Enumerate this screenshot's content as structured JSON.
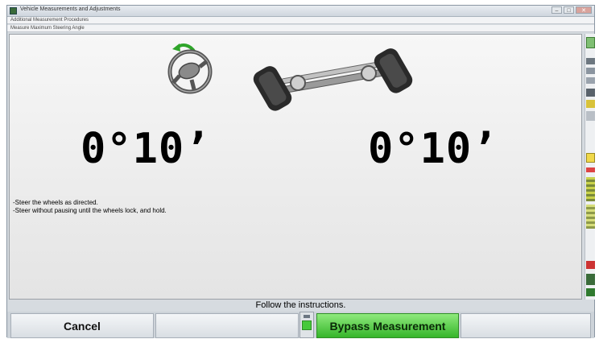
{
  "window": {
    "title": "Vehicle Measurements and Adjustments",
    "controls": {
      "minimize": "–",
      "maximize": "□",
      "close": "✕"
    }
  },
  "breadcrumbs": [
    "Additional Measurement Procedures",
    "Measure Maximum Steering Angle"
  ],
  "readings": {
    "left": "0°10’",
    "right": "0°10’"
  },
  "instructions": [
    "-Steer the wheels as directed.",
    "-Steer without pausing until the wheels lock, and hold."
  ],
  "status_text": "Follow the instructions.",
  "buttons": {
    "cancel": "Cancel",
    "empty": "",
    "bypass": "Bypass Measurement",
    "right_empty": ""
  },
  "icons": {
    "steering_direction": "counterclockwise-arrow-icon",
    "steering": "steering-wheel-icon",
    "axle": "front-axle-icon"
  },
  "colors": {
    "accent_green": "#35b52a",
    "arrow_green": "#2fa52a"
  }
}
